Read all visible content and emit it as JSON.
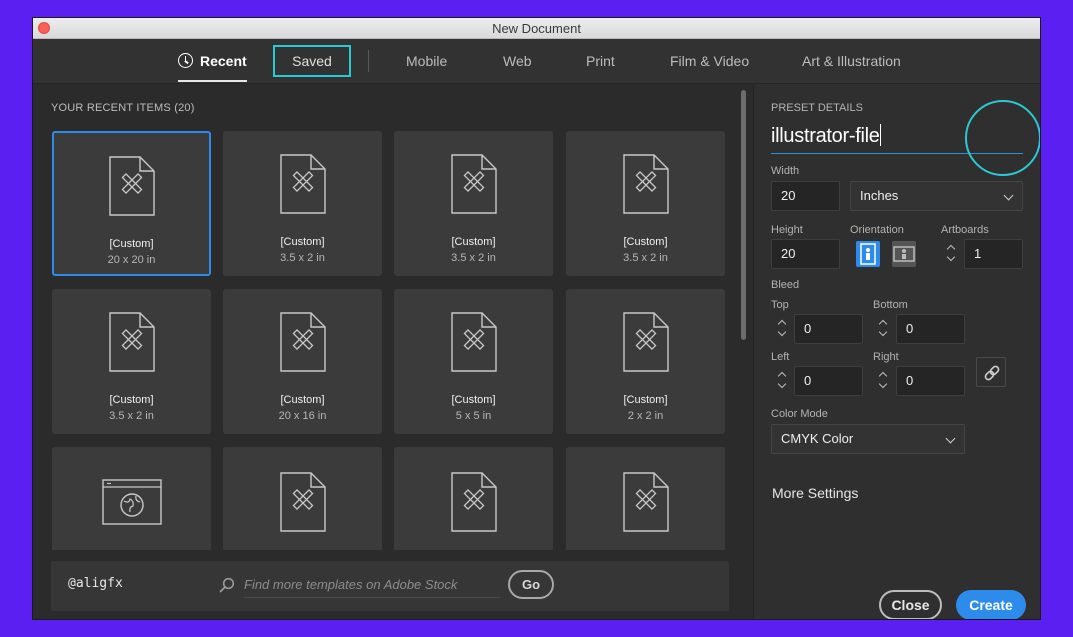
{
  "window": {
    "title": "New Document"
  },
  "tabs": [
    {
      "label": "Recent"
    },
    {
      "label": "Saved"
    },
    {
      "label": "Mobile"
    },
    {
      "label": "Web"
    },
    {
      "label": "Print"
    },
    {
      "label": "Film & Video"
    },
    {
      "label": "Art & Illustration"
    }
  ],
  "recent": {
    "heading": "YOUR RECENT ITEMS",
    "count": "(20)",
    "items": [
      {
        "name": "[Custom]",
        "size": "20 x 20 in"
      },
      {
        "name": "[Custom]",
        "size": "3.5 x 2 in"
      },
      {
        "name": "[Custom]",
        "size": "3.5 x 2 in"
      },
      {
        "name": "[Custom]",
        "size": "3.5 x 2 in"
      },
      {
        "name": "[Custom]",
        "size": "3.5 x 2 in"
      },
      {
        "name": "[Custom]",
        "size": "20 x 16 in"
      },
      {
        "name": "[Custom]",
        "size": "5 x 5 in"
      },
      {
        "name": "[Custom]",
        "size": "2 x 2 in"
      }
    ]
  },
  "footer": {
    "watermark": "@aligfx",
    "search_placeholder": "Find more templates on Adobe Stock",
    "go_label": "Go"
  },
  "preset": {
    "heading": "PRESET DETAILS",
    "name": "illustrator-file",
    "width_label": "Width",
    "width_value": "20",
    "units": "Inches",
    "height_label": "Height",
    "height_value": "20",
    "orientation_label": "Orientation",
    "artboards_label": "Artboards",
    "artboards_value": "1",
    "bleed_label": "Bleed",
    "bleed_top_label": "Top",
    "bleed_top": "0",
    "bleed_bottom_label": "Bottom",
    "bleed_bottom": "0",
    "bleed_left_label": "Left",
    "bleed_left": "0",
    "bleed_right_label": "Right",
    "bleed_right": "0",
    "color_mode_label": "Color Mode",
    "color_mode": "CMYK Color",
    "more_settings": "More Settings",
    "close_label": "Close",
    "create_label": "Create"
  },
  "colors": {
    "accent": "#2d8ceb",
    "highlight": "#29c9d6",
    "background": "#5b1ff2"
  }
}
